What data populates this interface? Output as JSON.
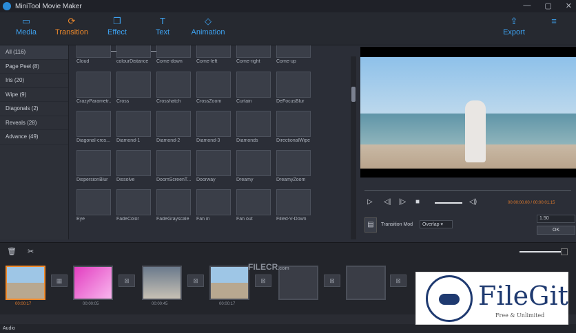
{
  "window": {
    "title": "MiniTool Movie Maker",
    "controls": [
      "—",
      "▢",
      "✕"
    ]
  },
  "toolbar": {
    "items": [
      {
        "label": "Media",
        "icon": "folder-icon"
      },
      {
        "label": "Transition",
        "icon": "transition-icon"
      },
      {
        "label": "Effect",
        "icon": "effect-icon"
      },
      {
        "label": "Text",
        "icon": "text-icon"
      },
      {
        "label": "Animation",
        "icon": "animation-icon"
      }
    ],
    "export_label": "Export"
  },
  "sidebar": {
    "items": [
      {
        "label": "All (116)"
      },
      {
        "label": "Page Peel (8)"
      },
      {
        "label": "Iris (20)"
      },
      {
        "label": "Wipe (9)"
      },
      {
        "label": "Diagonals (2)"
      },
      {
        "label": "Reveals (28)"
      },
      {
        "label": "Advance (49)"
      }
    ]
  },
  "transitions": [
    "Cloud",
    "colourDistance",
    "Come-down",
    "Come-left",
    "Come-right",
    "Come-up",
    "CrazyParametr...",
    "Cross",
    "Crosshatch",
    "CrossZoom",
    "Curtain",
    "DeFocusBlur",
    "Diagonal-cros...",
    "Diamond-1",
    "Diamond-2",
    "Diamond-3",
    "Diamonds",
    "DirectionalWipe",
    "DispersionBlur",
    "Dissolve",
    "DoomScreenT...",
    "Doorway",
    "Dreamy",
    "DreamyZoom",
    "Eye",
    "FadeColor",
    "FadeGrayscale",
    "Fan in",
    "Fan out",
    "Filled-V-Down"
  ],
  "preview": {
    "time": "00:00:00.00 / 00:00:01.15",
    "transition_mode_label": "Transition Mod",
    "transition_mode_value": "Overlap",
    "speed_value": "1.50",
    "ok_label": "OK"
  },
  "timeline": {
    "clips": [
      {
        "time": "00:00:17",
        "selected": true
      },
      {
        "time": "00:00:05",
        "selected": false
      },
      {
        "time": "00:00:45",
        "selected": false
      },
      {
        "time": "00:00:17",
        "selected": false
      }
    ],
    "audio_label": "Audio"
  },
  "watermarks": {
    "filecr": "FILECR",
    "filecr_sub": ".com",
    "filegit": "FileGit",
    "filegit_sub": "Free & Unlimited"
  }
}
